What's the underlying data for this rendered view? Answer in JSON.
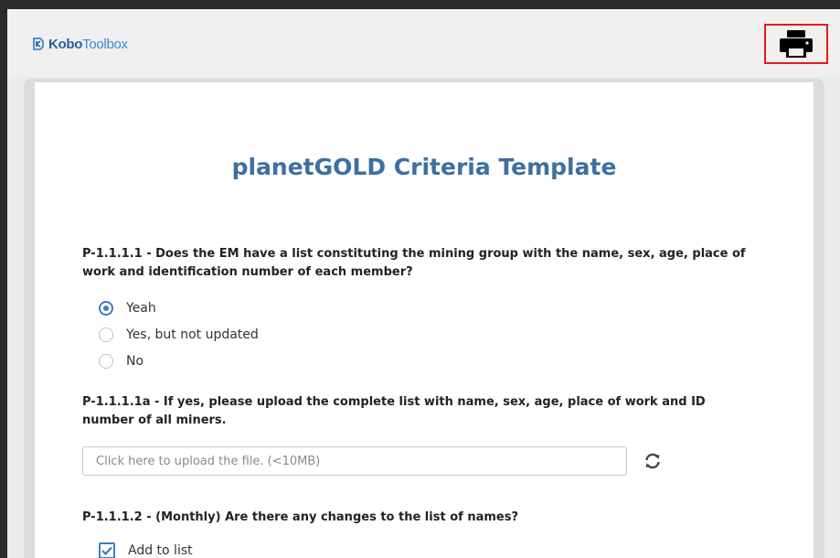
{
  "header": {
    "logo_kobo": "Kobo",
    "logo_toolbox": "Toolbox",
    "print_icon": "printer-icon"
  },
  "form": {
    "title": "planetGOLD Criteria Template",
    "questions": [
      {
        "label": "P-1.1.1.1 - Does the EM have a list constituting the mining group with the name, sex, age, place of work and identification number of each member?",
        "type": "radio",
        "options": [
          {
            "label": "Yeah",
            "checked": true
          },
          {
            "label": "Yes, but not updated",
            "checked": false
          },
          {
            "label": "No",
            "checked": false
          }
        ]
      },
      {
        "label": "P-1.1.1.1a - If yes, please upload the complete list with name, sex, age, place of work and ID number of all miners.",
        "type": "file",
        "placeholder": "Click here to upload the file. (<10MB)",
        "refresh_icon": "refresh-icon"
      },
      {
        "label": "P-1.1.1.2 - (Monthly) Are there any changes to the list of names?",
        "type": "checkbox",
        "options": [
          {
            "label": "Add to list",
            "checked": true
          }
        ]
      }
    ]
  },
  "colors": {
    "accent": "#3d7bc4",
    "title": "#3e6fa0",
    "highlight_box": "#e81a1a"
  }
}
